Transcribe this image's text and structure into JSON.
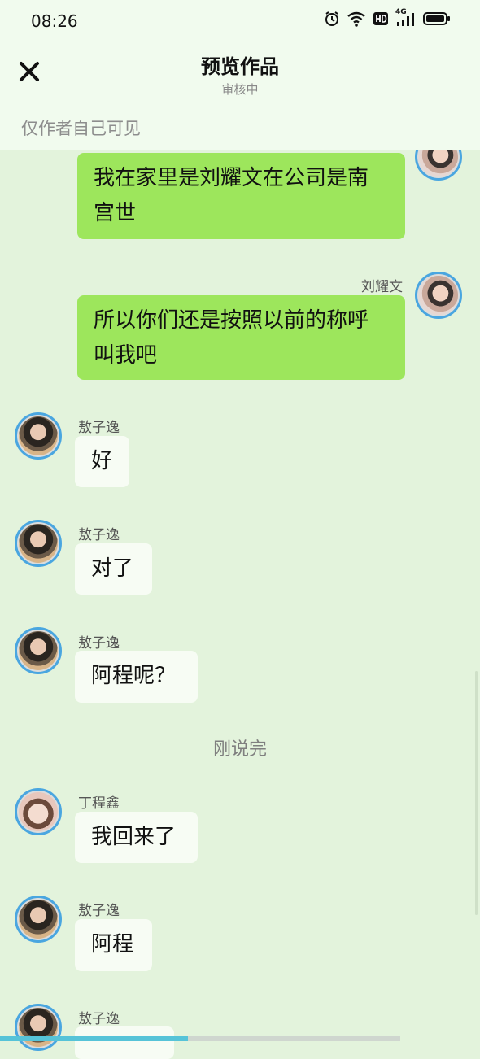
{
  "status": {
    "time": "08:26",
    "network": "4G"
  },
  "header": {
    "title": "预览作品",
    "subtitle": "审核中",
    "visibility_note": "仅作者自己可见"
  },
  "messages": [
    {
      "side": "right",
      "text_lines": [
        "我在家里是刘耀文在公司是南",
        "宫世"
      ]
    },
    {
      "side": "right",
      "sender": "刘耀文",
      "text_lines": [
        "所以你们还是按照以前的称呼",
        "叫我吧"
      ]
    },
    {
      "side": "left",
      "sender": "敖子逸",
      "text": "好"
    },
    {
      "side": "left",
      "sender": "敖子逸",
      "text": "对了"
    },
    {
      "side": "left",
      "sender": "敖子逸",
      "text": "阿程呢？"
    },
    {
      "type": "narration",
      "text": "刚说完"
    },
    {
      "side": "left",
      "sender": "丁程鑫",
      "text": "我回来了"
    },
    {
      "side": "left",
      "sender": "敖子逸",
      "text": "阿程"
    },
    {
      "side": "left",
      "sender": "敖子逸",
      "text": ""
    }
  ],
  "progress": {
    "value": 0.47
  },
  "colors": {
    "accent": "#4aa6e0",
    "right_bubble": "#9de65c",
    "left_bubble": "#f7fcf4",
    "background": "#e3f3dc"
  }
}
